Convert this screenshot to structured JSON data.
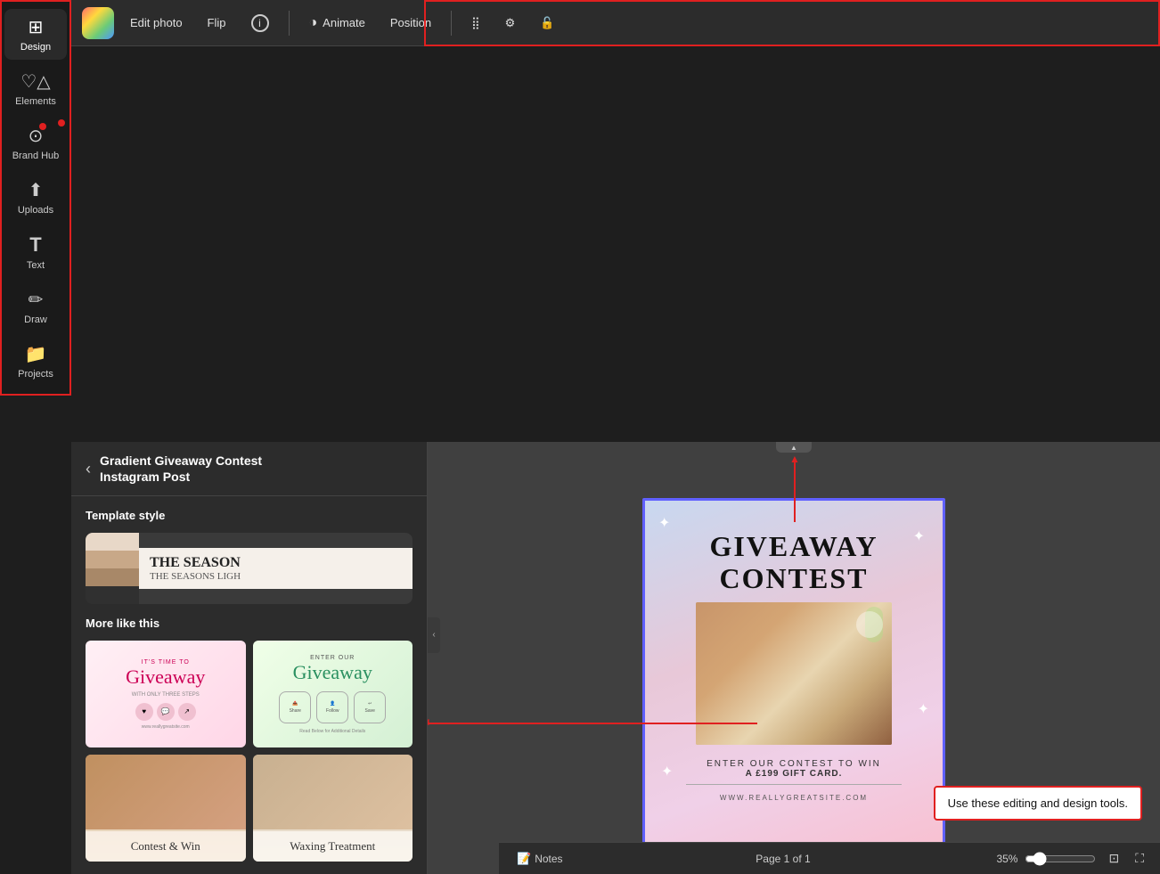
{
  "app": {
    "title": "Gradient Giveaway Contest Instagram Post"
  },
  "toolbar": {
    "edit_photo": "Edit photo",
    "flip": "Flip",
    "info": "ℹ",
    "animate": "Animate",
    "position": "Position"
  },
  "sidebar": {
    "items": [
      {
        "id": "design",
        "label": "Design",
        "icon": "⊞",
        "active": true
      },
      {
        "id": "elements",
        "label": "Elements",
        "icon": "♡△"
      },
      {
        "id": "brand-hub",
        "label": "Brand Hub",
        "icon": "⊙",
        "has_dot": true
      },
      {
        "id": "uploads",
        "label": "Uploads",
        "icon": "↑"
      },
      {
        "id": "text",
        "label": "Text",
        "icon": "T"
      },
      {
        "id": "draw",
        "label": "Draw",
        "icon": "✏"
      },
      {
        "id": "projects",
        "label": "Projects",
        "icon": "📁"
      }
    ]
  },
  "panel": {
    "back_label": "‹",
    "title_line1": "Gradient Giveaway Contest",
    "title_line2": "Instagram Post",
    "template_style_section": "Template style",
    "template_text_line1": "THE SEASON",
    "template_text_line2": "THE SEASONS LIGH",
    "more_like_this": "More like this",
    "templates": [
      {
        "id": "t1",
        "name": "Pink Giveaway",
        "title": "IT'S TIME TO",
        "main": "Giveaway",
        "sub": "WITH ONLY THREE STEPS"
      },
      {
        "id": "t2",
        "name": "Mint Giveaway",
        "title": "ENTER OUR",
        "main": "Giveaway"
      },
      {
        "id": "t3",
        "name": "Contest and Win",
        "text": "Contest & Win"
      },
      {
        "id": "t4",
        "name": "Waxing Treatment",
        "text": "Waxing Treatment"
      }
    ]
  },
  "canvas": {
    "card_toolbar_delete": "🗑",
    "card_toolbar_more": "···",
    "design": {
      "heading1": "GIVEAWAY",
      "heading2": "CONTEST",
      "subtitle": "ENTER OUR CONTEST TO WIN",
      "prize": "A £199 GIFT CARD.",
      "website": "WWW.REALLYGREATSITE.COM"
    },
    "tooltip": "Use these editing and design tools."
  },
  "bottom_bar": {
    "notes_label": "Notes",
    "page_label": "Page 1 of 1",
    "zoom_value": "35%",
    "scroll_up_icon": "▲"
  }
}
